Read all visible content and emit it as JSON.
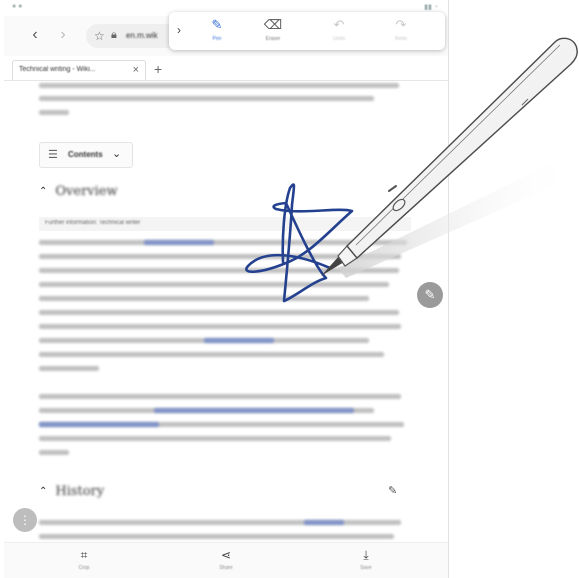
{
  "browser": {
    "url": "en.m.wik",
    "tab_title": "Technical writing - Wiki..."
  },
  "pen_toolbar": {
    "items": [
      {
        "label": "Pen",
        "icon": "pen-icon",
        "state": "active"
      },
      {
        "label": "Eraser",
        "icon": "eraser-icon",
        "state": "normal"
      },
      {
        "label": "Undo",
        "icon": "undo-icon",
        "state": "disabled"
      },
      {
        "label": "Redo",
        "icon": "redo-icon",
        "state": "disabled"
      }
    ],
    "accent": "#3a6fd8"
  },
  "article": {
    "contents_label": "Contents",
    "sections": [
      {
        "title": "Overview"
      },
      {
        "title": "History"
      }
    ],
    "hatnote": "Further information: Technical writer"
  },
  "bottom_bar": {
    "items": [
      {
        "label": "Crop",
        "icon": "crop-icon"
      },
      {
        "label": "Share",
        "icon": "share-icon"
      },
      {
        "label": "Save",
        "icon": "save-icon"
      }
    ]
  },
  "colors": {
    "ink": "#24418f",
    "link_text": "#4d6fd1"
  }
}
